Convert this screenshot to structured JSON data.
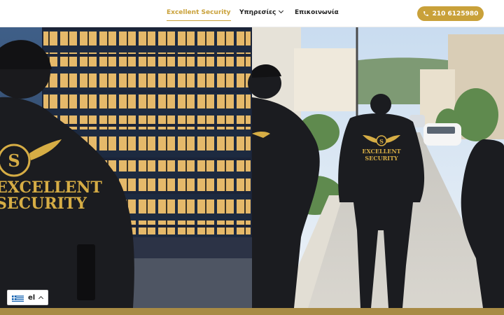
{
  "header": {
    "nav": [
      {
        "label": "Excellent Security",
        "active": true
      },
      {
        "label": "Υπηρεσίες",
        "has_dropdown": true
      },
      {
        "label": "Επικοινωνία"
      }
    ],
    "phone_button": {
      "label": "210 6125980",
      "icon": "phone-icon"
    }
  },
  "hero": {
    "left_image": {
      "jacket_text_line1": "EXCELLENT",
      "jacket_text_line2": "SECURITY",
      "emblem_letter": "S"
    },
    "right_image": {
      "jacket_text_line1": "EXCELLENT",
      "jacket_text_line2": "SECURITY",
      "emblem_letter": "S"
    }
  },
  "language_switcher": {
    "label": "el",
    "flag": "greek-flag-icon"
  },
  "colors": {
    "accent": "#c9a13a",
    "jacket": "#1b1c20",
    "gold_bar": "#a88b45"
  }
}
